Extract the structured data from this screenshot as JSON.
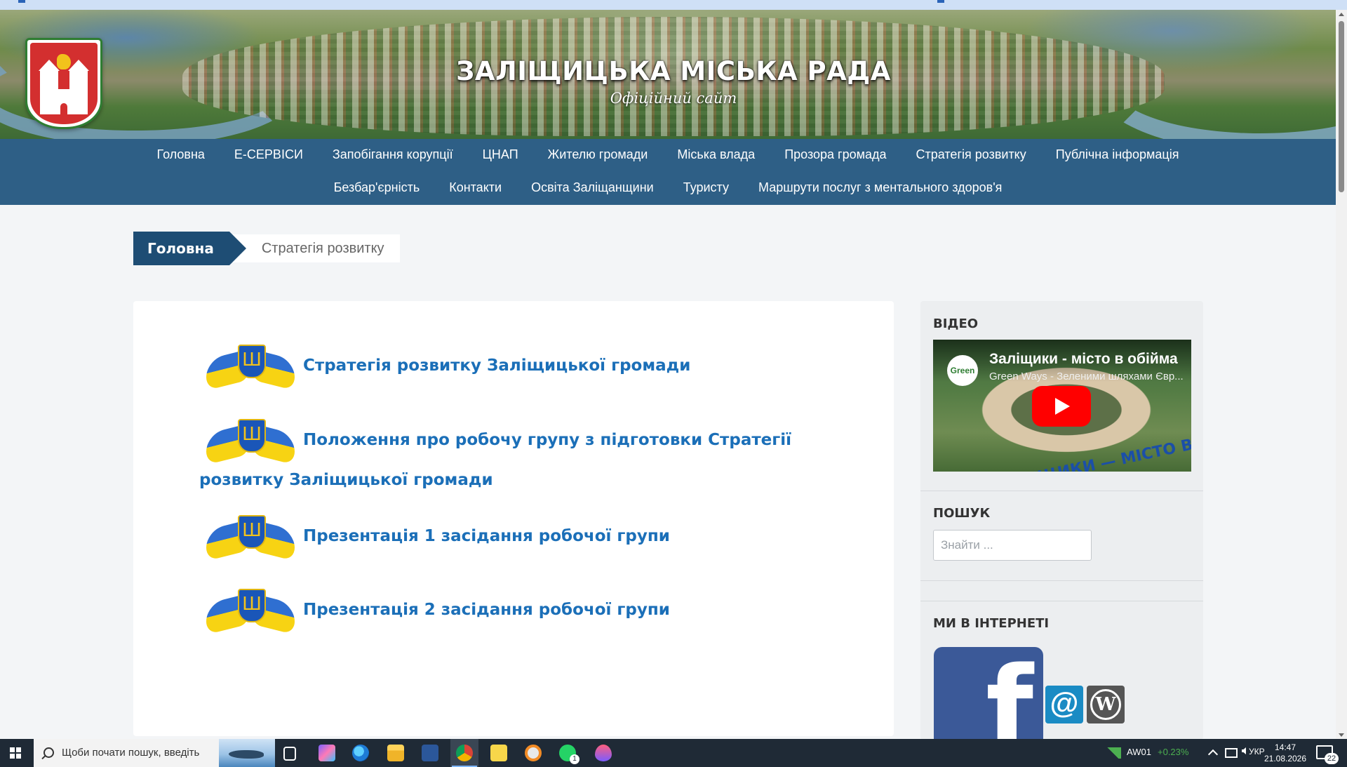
{
  "header": {
    "title": "ЗАЛІЩИЦЬКА МІСЬКА РАДА",
    "subtitle": "Офіційний сайт"
  },
  "nav": {
    "row1": [
      "Головна",
      "Е-СЕРВІСИ",
      "Запобігання корупції",
      "ЦНАП",
      "Жителю громади",
      "Міська влада",
      "Прозора громада",
      "Стратегія розвитку",
      "Публічна інформація"
    ],
    "row2": [
      "Безбар'єрність",
      "Контакти",
      "Освіта Заліщанщини",
      "Туристу",
      "Маршрути послуг з ментального здоров'я"
    ]
  },
  "breadcrumb": {
    "home": "Головна",
    "current": "Стратегія розвитку"
  },
  "documents": [
    {
      "line1": "Стратегія розвитку Заліщицької громади",
      "line2": ""
    },
    {
      "line1": "Положення про робочу групу з підготовки Стратегії",
      "line2": "розвитку Заліщицької громади"
    },
    {
      "line1": "Презентація 1 засідання робочої групи",
      "line2": ""
    },
    {
      "line1": "Презентація 2 засідання робочої групи",
      "line2": ""
    }
  ],
  "document_icon": "ukraine-trident-emblem-icon",
  "sidebar": {
    "video": {
      "heading": "ВІДЕО",
      "title": "Заліщики - місто в обійма",
      "channel": "Green Ways - Зеленими шляхами Євр...",
      "channel_logo": "Green",
      "overlay_text": "ЛІЩИКИ — МІСТО В ОБІЙМАХ ДНІСТРА"
    },
    "search": {
      "heading": "ПОШУК",
      "placeholder": "Знайти ..."
    },
    "social": {
      "heading": "МИ В ІНТЕРНЕТІ",
      "facebook_glyph": "f",
      "email_glyph": "@",
      "wordpress_glyph": "W"
    }
  },
  "taskbar": {
    "search_placeholder": "Щоби почати пошук, введіть",
    "stock_ticker": "AW01",
    "stock_change": "+0.23%",
    "language": "УКР",
    "time": "14:47",
    "date": "21.08.2026",
    "notifications": "22",
    "whatsapp_badge": "1"
  },
  "colors": {
    "nav_bg": "#2e5f86",
    "breadcrumb_home_bg": "#1e4d74",
    "link": "#1b6fb8",
    "facebook": "#3b5998",
    "stock_positive": "#4caf50"
  }
}
